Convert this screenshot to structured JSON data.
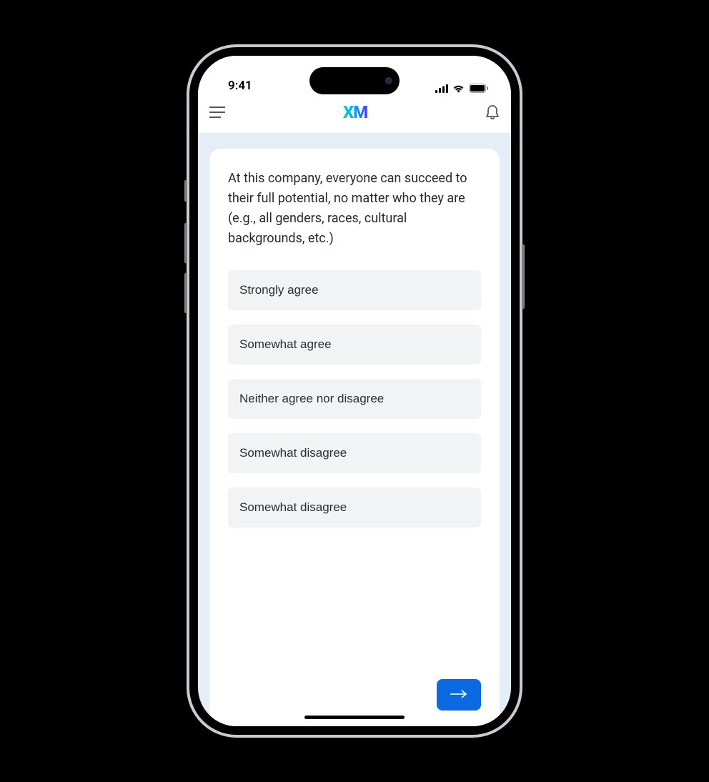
{
  "status": {
    "time": "9:41"
  },
  "header": {
    "logo_text": "XM"
  },
  "survey": {
    "question": "At this company, everyone can succeed to their full potential, no matter who they are (e.g., all genders, races, cultural backgrounds, etc.)",
    "options": [
      "Strongly agree",
      "Somewhat agree",
      "Neither agree nor disagree",
      "Somewhat disagree",
      "Somewhat disagree"
    ]
  }
}
